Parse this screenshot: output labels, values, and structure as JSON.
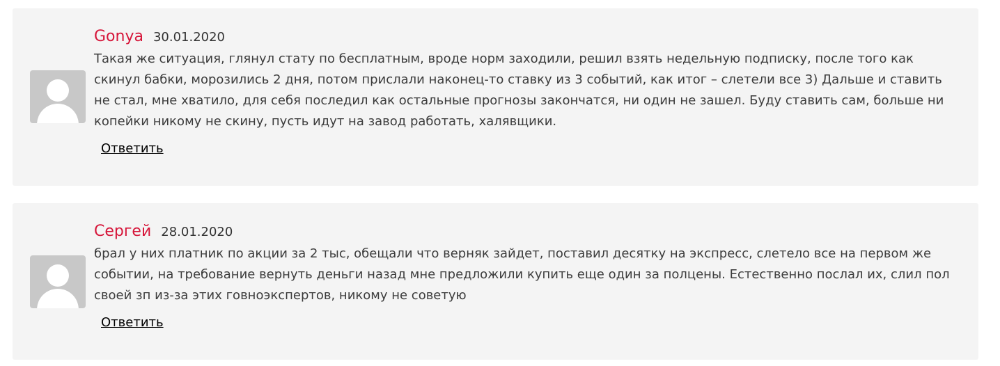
{
  "comments": [
    {
      "author": "Gonya",
      "date": "30.01.2020",
      "text": "Такая же ситуация, глянул стату по бесплатным, вроде норм заходили, решил взять недельную подписку, после того как скинул бабки, морозились 2 дня, потом прислали наконец-то ставку из 3 событий, как итог – слетели все 3) Дальше и ставить не стал, мне хватило, для себя последил как остальные прогнозы закончатся, ни один не зашел. Буду ставить сам, больше ни копейки никому не скину, пусть идут на завод работать, халявщики.",
      "reply_label": "Ответить",
      "avatar_icon": "user-placeholder-icon"
    },
    {
      "author": "Сергей",
      "date": "28.01.2020",
      "text": "брал у них платник по акции за 2 тыс, обещали что верняк зайдет, поставил десятку на экспресс, слетело все на первом же событии, на требование вернуть деньги назад мне предложили купить еще один за полцены. Естественно послал их, слил пол своей зп из-за этих говноэкспертов, никому не советую",
      "reply_label": "Ответить",
      "avatar_icon": "user-placeholder-icon"
    }
  ],
  "colors": {
    "author": "#d6163a",
    "card_background": "#f4f4f4",
    "avatar_background": "#c8c8c8",
    "text": "#3c3c3c"
  }
}
